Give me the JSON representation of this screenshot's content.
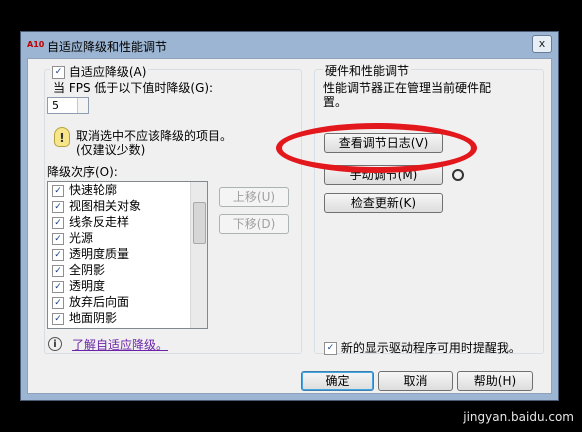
{
  "window": {
    "app_icon": "A10",
    "title": "自适应降级和性能调节",
    "close_label": "x"
  },
  "adaptive": {
    "enable_label": "自适应降级(A)",
    "enable_checked": "✓",
    "fps_label": "当 FPS 低于以下值时降级(G):",
    "fps_value": "5",
    "tip_icon": "!",
    "tip_text_line1": "取消选中不应该降级的项目。",
    "tip_text_line2": "(仅建议少数)",
    "order_label": "降级次序(O):",
    "items": [
      {
        "label": "快速轮廓",
        "checked": "✓"
      },
      {
        "label": "视图相关对象",
        "checked": "✓"
      },
      {
        "label": "线条反走样",
        "checked": "✓"
      },
      {
        "label": "光源",
        "checked": "✓"
      },
      {
        "label": "透明度质量",
        "checked": "✓"
      },
      {
        "label": "全阴影",
        "checked": "✓"
      },
      {
        "label": "透明度",
        "checked": "✓"
      },
      {
        "label": "放弃后向面",
        "checked": "✓"
      },
      {
        "label": "地面阴影",
        "checked": "✓"
      }
    ],
    "move_up_label": "上移(U)",
    "move_down_label": "下移(D)",
    "info_icon": "i",
    "learn_link": "了解自适应降级。"
  },
  "hardware": {
    "group_title": "硬件和性能调节",
    "status_line1": "性能调节器正在管理当前硬件配",
    "status_line2": "置。",
    "view_log_label": "查看调节日志(V)",
    "manual_tune_label": "手动调节(M)",
    "check_updates_label": "检查更新(K)",
    "notify_checked": "✓",
    "notify_label": "新的显示驱动程序可用时提醒我。"
  },
  "footer": {
    "ok_label": "确定",
    "cancel_label": "取消",
    "help_label": "帮助(H)"
  },
  "watermark": "jingyan.baidu.com",
  "colors": {
    "window_frame": "#9bb5d2",
    "annotation": "#e3181c",
    "link": "#6b24a8"
  }
}
